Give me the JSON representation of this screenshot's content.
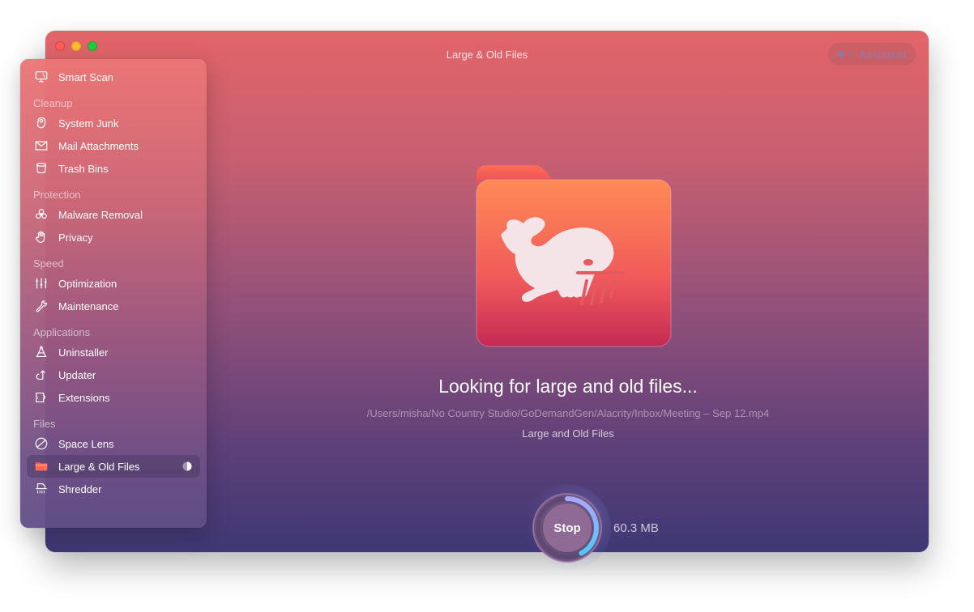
{
  "window": {
    "title": "Large & Old Files",
    "assistant_label": "Assistant"
  },
  "sidebar": {
    "top_item": {
      "label": "Smart Scan",
      "icon": "monitor-icon"
    },
    "sections": [
      {
        "title": "Cleanup",
        "items": [
          {
            "label": "System Junk",
            "icon": "system-junk-icon"
          },
          {
            "label": "Mail Attachments",
            "icon": "envelope-icon"
          },
          {
            "label": "Trash Bins",
            "icon": "trash-bin-icon"
          }
        ]
      },
      {
        "title": "Protection",
        "items": [
          {
            "label": "Malware Removal",
            "icon": "biohazard-icon"
          },
          {
            "label": "Privacy",
            "icon": "hand-icon"
          }
        ]
      },
      {
        "title": "Speed",
        "items": [
          {
            "label": "Optimization",
            "icon": "sliders-icon"
          },
          {
            "label": "Maintenance",
            "icon": "wrench-icon"
          }
        ]
      },
      {
        "title": "Applications",
        "items": [
          {
            "label": "Uninstaller",
            "icon": "uninstaller-icon"
          },
          {
            "label": "Updater",
            "icon": "update-arrow-icon"
          },
          {
            "label": "Extensions",
            "icon": "puzzle-icon"
          }
        ]
      },
      {
        "title": "Files",
        "items": [
          {
            "label": "Space Lens",
            "icon": "planet-icon"
          },
          {
            "label": "Large & Old Files",
            "icon": "folder-icon",
            "active": true,
            "progress_indicator": "half-pie-icon"
          },
          {
            "label": "Shredder",
            "icon": "shredder-icon"
          }
        ]
      }
    ]
  },
  "main": {
    "hero_icon": "whale-folder-icon",
    "headline": "Looking for large and old files...",
    "current_path": "/Users/misha/No Country Studio/GoDemandGen/Alacrity/Inbox/Meeting – Sep 12.mp4",
    "subtitle": "Large and Old Files",
    "stop_label": "Stop",
    "found_size": "60.3 MB",
    "scan_progress": 0.42
  },
  "colors": {
    "window_top": "#e26468",
    "window_bottom": "#3e3874",
    "progress_start": "#a9a8ff",
    "progress_end": "#4fc8ff",
    "folder_orange": "#ff7a55",
    "folder_crimson": "#c72d55"
  }
}
